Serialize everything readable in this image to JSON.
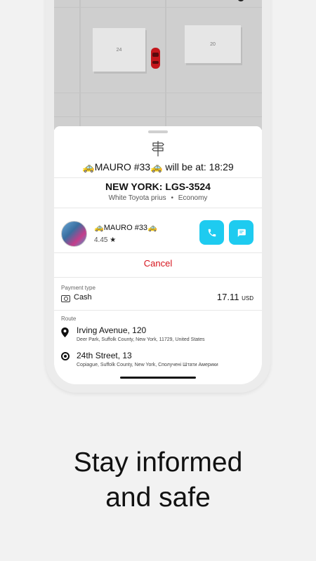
{
  "map": {
    "buildings": [
      "24",
      "20"
    ]
  },
  "sheet": {
    "eta_text": "🚕MAURO #33🚕 will be at: 18:29",
    "plate": "NEW YORK: LGS-3524",
    "car_model": "White Toyota prius",
    "separator": "•",
    "car_class": "Economy",
    "driver": {
      "name": "🚕MAURO #33🚕",
      "rating": "4.45",
      "star": "★"
    },
    "cancel_label": "Cancel",
    "payment": {
      "label": "Payment type",
      "method": "Cash",
      "amount": "17.11",
      "currency": "USD"
    },
    "route": {
      "label": "Route",
      "stops": [
        {
          "title": "Irving Avenue, 120",
          "subtitle": "Deer Park, Suffolk County, New York, 11729, United States"
        },
        {
          "title": "24th Street, 13",
          "subtitle": "Copiague, Suffolk County, New York, Сполучені Штати Америки"
        }
      ]
    }
  },
  "headline": {
    "line1": "Stay informed",
    "line2": "and safe"
  },
  "colors": {
    "accent": "#1ecbf0",
    "cancel": "#d6131c",
    "car": "#c4161c"
  },
  "icons": [
    "signpost-icon",
    "phone-icon",
    "chat-icon",
    "cash-icon",
    "location-pin-icon",
    "destination-dot-icon"
  ]
}
